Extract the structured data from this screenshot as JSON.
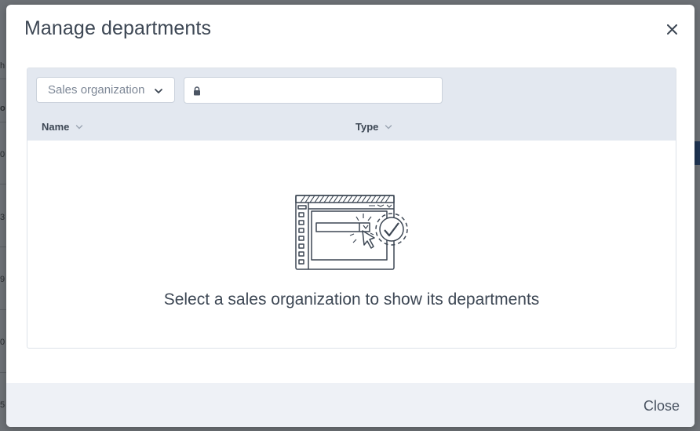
{
  "backdrop": {
    "fragments": [
      "h",
      "o",
      "0",
      "3",
      "9",
      "0",
      "5"
    ]
  },
  "modal": {
    "title": "Manage departments",
    "close_icon": "close-icon",
    "filter": {
      "sales_org_placeholder": "Sales organization",
      "search_value": "",
      "lock_icon": "lock-icon"
    },
    "columns": [
      {
        "label": "Name"
      },
      {
        "label": "Type"
      }
    ],
    "empty_state": {
      "icon": "select-item-illustration",
      "message": "Select a sales organization to show its departments"
    },
    "footer": {
      "close_label": "Close"
    }
  },
  "colors": {
    "title_text": "#3d4754",
    "panel_header_bg": "#e3e8f0",
    "footer_bg": "#eef1f6",
    "overlay": "#6d7176"
  }
}
